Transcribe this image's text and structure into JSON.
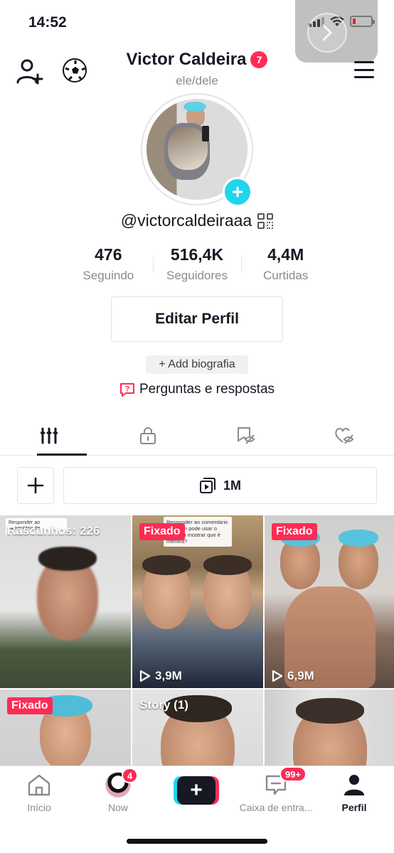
{
  "status_bar": {
    "time": "14:52",
    "battery_level": 0.1
  },
  "header": {
    "name": "Victor Caldeira",
    "name_badge": "7",
    "pronouns": "ele/dele",
    "icons": [
      "add-user-icon",
      "soccer-ball-icon",
      "hamburger-menu-icon"
    ]
  },
  "profile": {
    "username": "@victorcaldeiraaa",
    "stats": [
      {
        "value": "476",
        "label": "Seguindo"
      },
      {
        "value": "516,4K",
        "label": "Seguidores"
      },
      {
        "value": "4,4M",
        "label": "Curtidas"
      }
    ],
    "edit_button": "Editar Perfil",
    "bio_button": "+ Add biografia",
    "qa_label": "Perguntas e respostas"
  },
  "tabs": [
    {
      "name": "videos",
      "icon": "grid-icon",
      "active": true
    },
    {
      "name": "private",
      "icon": "lock-icon",
      "active": false
    },
    {
      "name": "reposts",
      "icon": "hidden-bookmark-icon",
      "active": false
    },
    {
      "name": "liked",
      "icon": "hidden-heart-icon",
      "active": false
    }
  ],
  "toolbar": {
    "collections_count": "1M"
  },
  "videos": [
    {
      "label": "Rascunhos: 226",
      "caption": "Responder ao comentário de ...",
      "views": ""
    },
    {
      "pinned": "Fixado",
      "caption": "Responder ao comentário de ... em pode usar o ...to?pra mostrar que é mentira?",
      "views": "3,9M"
    },
    {
      "pinned": "Fixado",
      "views": "6,9M"
    },
    {
      "pinned": "Fixado",
      "views": ""
    },
    {
      "label": "Story (1)",
      "views": ""
    },
    {
      "views": ""
    }
  ],
  "bottom_nav": {
    "items": [
      {
        "label": "Início",
        "icon": "home-icon"
      },
      {
        "label": "Now",
        "icon": "now-avatar",
        "badge": "4"
      },
      {
        "label": "",
        "icon": "create-icon"
      },
      {
        "label": "Caixa de entra...",
        "icon": "inbox-icon",
        "badge": "99+"
      },
      {
        "label": "Perfil",
        "icon": "profile-icon",
        "active": true
      }
    ]
  },
  "colors": {
    "accent": "#fe2c55",
    "cyan": "#20d5ec",
    "text": "#161823",
    "muted": "#8a8b91"
  }
}
